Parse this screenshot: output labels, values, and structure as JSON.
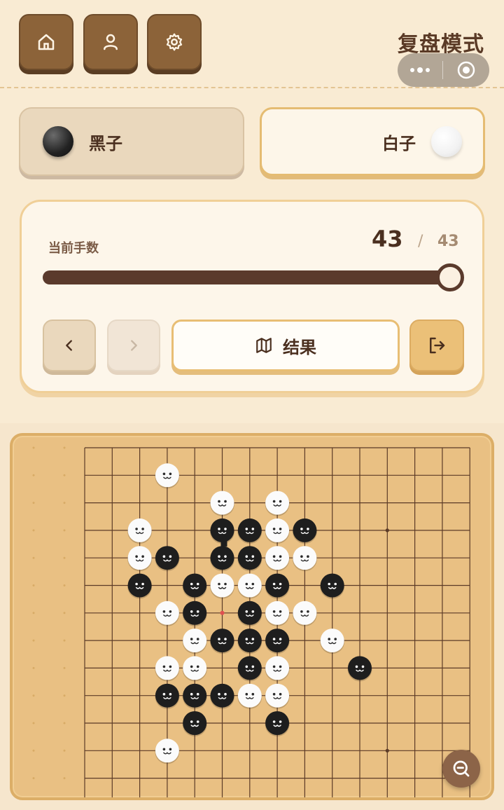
{
  "header": {
    "title": "复盘模式",
    "nav_buttons": [
      "home-icon",
      "user-icon",
      "gear-icon"
    ],
    "capsule_icons": [
      "more-icon",
      "target-icon"
    ]
  },
  "players": {
    "black": {
      "label": "黑子",
      "active": false
    },
    "white": {
      "label": "白子",
      "active": true
    }
  },
  "replay": {
    "step_label": "当前手数",
    "current_step": "43",
    "separator": "/",
    "total_steps": "43",
    "progress": 1.0,
    "result_label": "结果",
    "prev_enabled": true,
    "next_enabled": false
  },
  "colors": {
    "accent": "#e8be74",
    "dark_brown": "#5a3a2c",
    "board": "#e9c083"
  },
  "board": {
    "grid_lines": 15,
    "star_points": [
      [
        7,
        3
      ],
      [
        7,
        7
      ],
      [
        3,
        11
      ],
      [
        11,
        11
      ],
      [
        11,
        3
      ]
    ],
    "last_move": [
      5,
      6
    ],
    "black_stones": [
      [
        5,
        3
      ],
      [
        6,
        3
      ],
      [
        8,
        3
      ],
      [
        3,
        4
      ],
      [
        5,
        4
      ],
      [
        6,
        4
      ],
      [
        2,
        5
      ],
      [
        4,
        5
      ],
      [
        7,
        5
      ],
      [
        9,
        5
      ],
      [
        4,
        6
      ],
      [
        6,
        6
      ],
      [
        5,
        7
      ],
      [
        6,
        7
      ],
      [
        7,
        7
      ],
      [
        6,
        8
      ],
      [
        10,
        8
      ],
      [
        3,
        9
      ],
      [
        4,
        9
      ],
      [
        5,
        9
      ],
      [
        4,
        10
      ],
      [
        7,
        10
      ]
    ],
    "white_stones": [
      [
        3,
        1
      ],
      [
        5,
        2
      ],
      [
        7,
        2
      ],
      [
        2,
        3
      ],
      [
        7,
        3
      ],
      [
        2,
        4
      ],
      [
        7,
        4
      ],
      [
        8,
        4
      ],
      [
        5,
        5
      ],
      [
        6,
        5
      ],
      [
        3,
        6
      ],
      [
        7,
        6
      ],
      [
        8,
        6
      ],
      [
        4,
        7
      ],
      [
        9,
        7
      ],
      [
        3,
        8
      ],
      [
        4,
        8
      ],
      [
        7,
        8
      ],
      [
        6,
        9
      ],
      [
        7,
        9
      ],
      [
        3,
        11
      ]
    ],
    "marker": [
      5,
      3
    ]
  }
}
